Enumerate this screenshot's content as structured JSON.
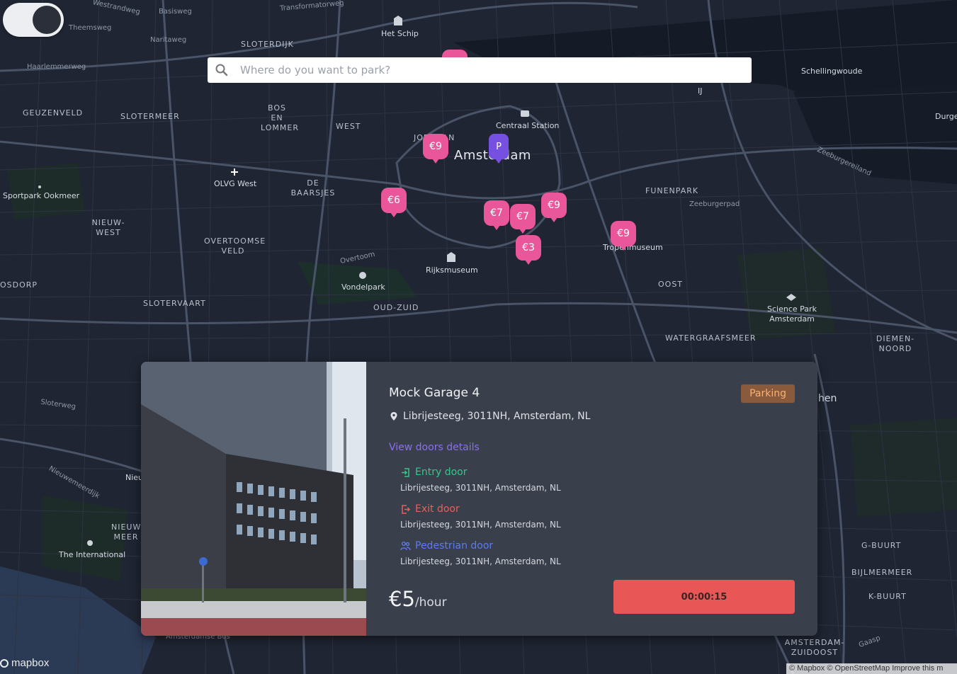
{
  "search": {
    "placeholder": "Where do you want to park?"
  },
  "map": {
    "labels": {
      "westrandweg": "Westrandweg",
      "basisweg": "Basisweg",
      "transformatorweg": "Transformatorweg",
      "het_schip": "Het Schip",
      "theemsweg": "Theemsweg",
      "naritaweg": "Naritaweg",
      "sloterdijk": "SLOTERDIJK",
      "haarlemmerweg": "Haarlemmerweg",
      "schellingwoude": "Schellingwoude",
      "ij": "IJ",
      "geuzenveld": "GEUZENVELD",
      "slotermeer": "SLOTERMEER",
      "bos_en_lommer": "BOS EN LOMMER",
      "west": "WEST",
      "jordaan": "JORDAAN",
      "centraal": "Centraal Station",
      "amsterdam": "Amsterdam",
      "durge": "Durge",
      "zeeburgereiland": "Zeeburgereiland",
      "olvg": "OLVG West",
      "sportpark": "Sportpark Ookmeer",
      "de_baarsjes": "DE BAARSJES",
      "funenpark": "FUNENPARK",
      "zeeburgerpad": "Zeeburgerpad",
      "nieuw_west": "NIEUW-WEST",
      "overtoomse_veld": "OVERTOOMSE VELD",
      "tropenmuseum": "Tropenmuseum",
      "overtoom": "Overtoom",
      "rijksmuseum": "Rijksmuseum",
      "vondelpark": "Vondelpark",
      "osdorp": "OSDORP",
      "oost": "OOST",
      "slotervaart": "SLOTERVAART",
      "oud_zuid": "OUD-ZUID",
      "science_park": "Science Park Amsterdam",
      "watergraafsmeer": "WATERGRAAFSMEER",
      "diemen_noord": "DIEMEN-NOORD",
      "sloterweg": "Sloterweg",
      "nieuwe_meerdijk": "Nieuwemeerdijk",
      "nieuw_meer": "NIEUW MEER",
      "the_international": "The International",
      "g_buurt": "G-BUURT",
      "bijlmermeer": "BIJLMERMEER",
      "k_buurt": "K-BUURT",
      "amsterdam_zuidoost": "AMSTERDAM-ZUIDOOST",
      "amsterdamse_bos": "Amsterdamse Bos",
      "nieu": "Nieu",
      "hen": "hen",
      "gaasp": "Gaasp"
    },
    "markers": [
      {
        "label": "€9"
      },
      {
        "label": "P"
      },
      {
        "label": "€6"
      },
      {
        "label": "€7"
      },
      {
        "label": "€7"
      },
      {
        "label": "€9"
      },
      {
        "label": "€3"
      },
      {
        "label": "€9"
      }
    ],
    "mapbox_logo": "mapbox",
    "attribution": "© Mapbox © OpenStreetMap Improve this m"
  },
  "card": {
    "title": "Mock Garage 4",
    "badge": "Parking",
    "address": "Librijesteeg, 3011NH, Amsterdam, NL",
    "doors_link": "View doors details",
    "doors": [
      {
        "type": "Entry door",
        "address": "Librijesteeg, 3011NH, Amsterdam, NL"
      },
      {
        "type": "Exit door",
        "address": "Librijesteeg, 3011NH, Amsterdam, NL"
      },
      {
        "type": "Pedestrian door",
        "address": "Librijesteeg, 3011NH, Amsterdam, NL"
      }
    ],
    "price": "€5",
    "price_unit": "/hour",
    "timer": "00:00:15"
  },
  "colors": {
    "marker_pink": "#e9579a",
    "marker_purple": "#7650e0",
    "entry": "#34c78a",
    "exit": "#f05b5b",
    "pedestrian": "#5b7cf0",
    "timer_bg": "#e85656",
    "card_bg": "#3a3f4c",
    "badge_bg": "#8a5a3d"
  }
}
